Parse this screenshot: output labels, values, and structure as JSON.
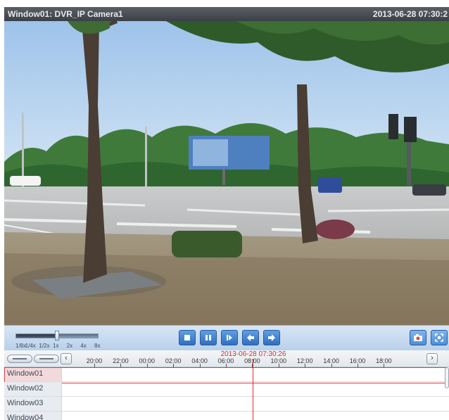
{
  "titlebar": {
    "window_label": "Window01:  DVR_IP Camera1",
    "timestamp": "2013-06-28 07:30:2"
  },
  "colors": {
    "accent": "#2f6fbf",
    "cursor": "#e02a2a",
    "titlebar": "#3b4046"
  },
  "playback": {
    "speed_labels": [
      "1/8x",
      "1/4x",
      "1/2x",
      "1x",
      "2x",
      "4x",
      "8x"
    ],
    "speed_selected": "1x",
    "speed_level": 0.5,
    "buttons": [
      {
        "name": "stop",
        "icon": "stop-icon"
      },
      {
        "name": "pause",
        "icon": "pause-icon"
      },
      {
        "name": "single-frame",
        "icon": "step-forward-icon"
      },
      {
        "name": "slow-backward",
        "icon": "arrow-left-icon"
      },
      {
        "name": "fast-forward",
        "icon": "arrow-right-icon"
      }
    ],
    "right_buttons": [
      {
        "name": "capture",
        "icon": "camera-icon"
      },
      {
        "name": "fullscreen",
        "icon": "fullscreen-icon"
      }
    ]
  },
  "timeline": {
    "cursor_time": "2013-06-28 07:30:26",
    "tick_labels": [
      "20:00",
      "22:00",
      "00:00",
      "02:00",
      "04:00",
      "06:00",
      "08:00",
      "10:00",
      "12:00",
      "14:00",
      "16:00",
      "18:00"
    ],
    "channels": [
      {
        "label": "Window01",
        "selected": true
      },
      {
        "label": "Window02",
        "selected": false
      },
      {
        "label": "Window03",
        "selected": false
      },
      {
        "label": "Window04",
        "selected": false
      }
    ],
    "prev_icon": "chevron-left-icon",
    "next_icon": "chevron-right-icon"
  }
}
